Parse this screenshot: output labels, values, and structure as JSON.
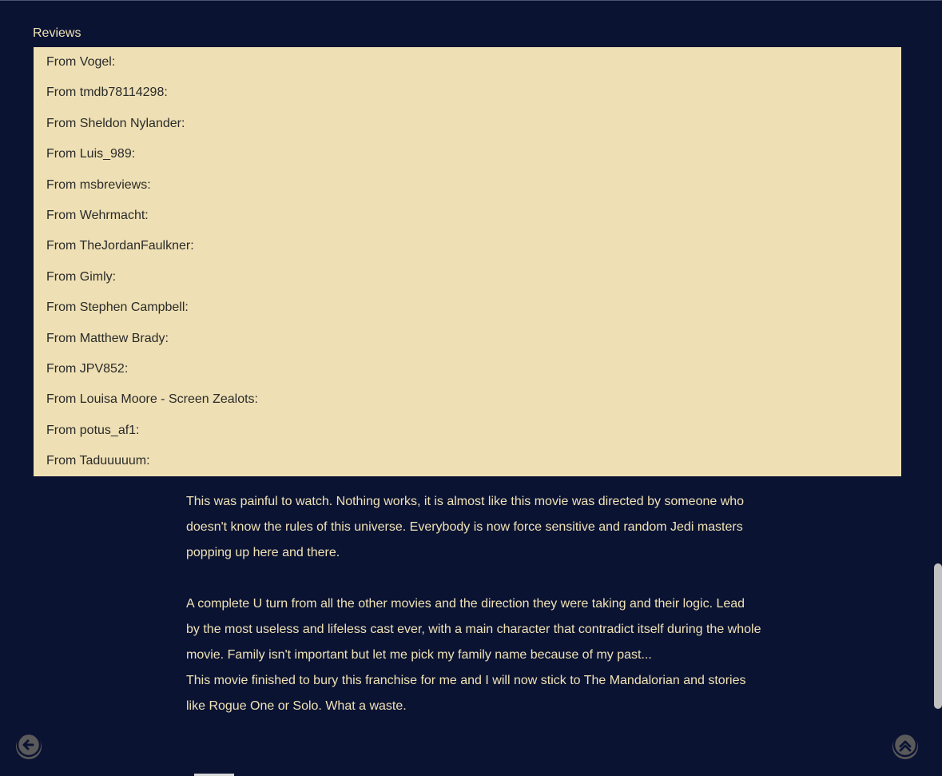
{
  "reviews_section": {
    "heading": "Reviews",
    "items": [
      {
        "label": "From Vogel:"
      },
      {
        "label": "From tmdb78114298:"
      },
      {
        "label": "From Sheldon Nylander:"
      },
      {
        "label": "From Luis_989:"
      },
      {
        "label": "From msbreviews:"
      },
      {
        "label": "From Wehrmacht:"
      },
      {
        "label": "From TheJordanFaulkner:"
      },
      {
        "label": "From Gimly:"
      },
      {
        "label": "From Stephen Campbell:"
      },
      {
        "label": "From Matthew Brady:"
      },
      {
        "label": "From JPV852:"
      },
      {
        "label": "From Louisa Moore - Screen Zealots:"
      },
      {
        "label": "From potus_af1:"
      },
      {
        "label": "From Taduuuuum:"
      }
    ]
  },
  "review_text": {
    "paragraph1": "This was painful to watch. Nothing works, it is almost like this movie was directed by someone who doesn't know the rules of this universe. Everybody is now force sensitive and random Jedi masters popping up here and there.",
    "paragraph2": "A complete U turn from all the other movies and the direction they were taking and their logic. Lead by the most useless and lifeless cast ever, with a main character that contradict itself during the whole movie. Family isn't important but let me pick my family name because of my past...",
    "paragraph3": "This movie finished to bury this franchise for me and I will now stick to The Mandalorian and stories like Rogue One or Solo. What a waste."
  },
  "navigation": {
    "back_icon": "arrow-left-circle-icon",
    "top_icon": "chevron-up-circle-icon"
  },
  "colors": {
    "background": "#0b1333",
    "text": "#efe2b5",
    "list_background": "#eee0b4",
    "list_text": "#2a2a2a",
    "button": "#5a5a5a",
    "scrollbar_thumb": "#c1c1c1"
  }
}
